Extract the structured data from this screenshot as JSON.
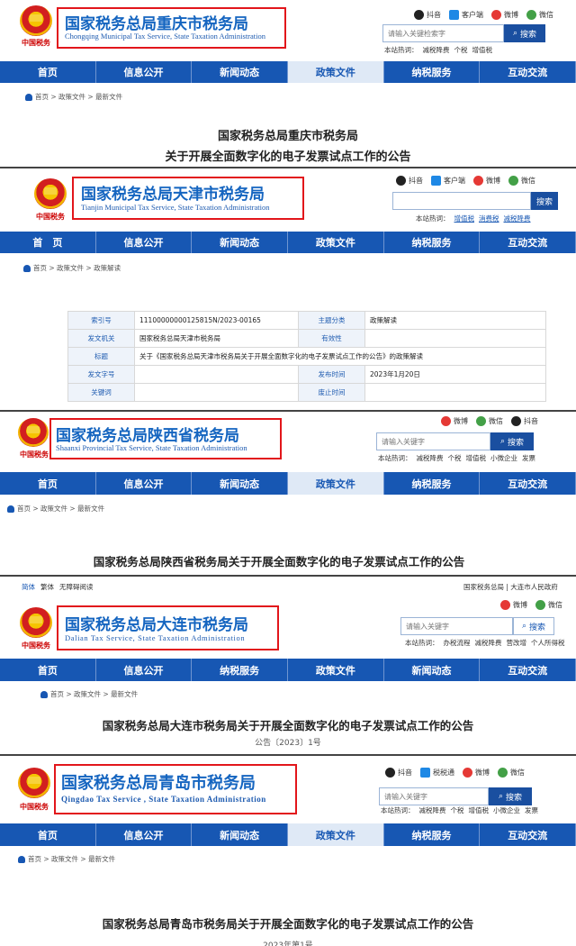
{
  "colors": {
    "nav": "#1757b3",
    "title": "#1565c0",
    "highlight_box": "#e2161b"
  },
  "panels": [
    {
      "title_cn": "国家税务总局重庆市税务局",
      "title_en": "Chongqing Municipal Tax Service, State Taxation Administration",
      "social": [
        "抖音",
        "客户端",
        "微博",
        "微信"
      ],
      "search_placeholder": "请输入关键检索字",
      "search_button": "搜索",
      "hot": [
        "本站热词：",
        "减税降费",
        "个税",
        "增值税"
      ],
      "nav": [
        "首页",
        "信息公开",
        "新闻动态",
        "政策文件",
        "纳税服务",
        "互动交流"
      ],
      "active_nav": "政策文件",
      "breadcrumb": "首页 > 政策文件 > 最新文件",
      "doc_line1": "国家税务总局重庆市税务局",
      "doc_line2": "关于开展全面数字化的电子发票试点工作的公告",
      "seal": "中国税务"
    },
    {
      "title_cn": "国家税务总局天津市税务局",
      "title_en": "Tianjin Municipal Tax Service, State Taxation Administration",
      "social": [
        "抖音",
        "客户端",
        "微博",
        "微信"
      ],
      "search_button": "搜索",
      "hot": [
        "本站热词：",
        "增值税",
        "消费税",
        "减税降费"
      ],
      "nav": [
        "首　页",
        "信息公开",
        "新闻动态",
        "政策文件",
        "纳税服务",
        "互动交流"
      ],
      "breadcrumb": "首页 > 政策文件 > 政策解读",
      "table": {
        "index_k": "索引号",
        "index_v": "11100000000125815N/2023-00165",
        "topic_k": "主题分类",
        "topic_v": "政策解读",
        "org_k": "发文机关",
        "org_v": "国家税务总局天津市税务局",
        "valid_k": "有效性",
        "valid_v": "",
        "title_k": "标题",
        "title_v": "关于《国家税务总局天津市税务局关于开展全面数字化的电子发票试点工作的公告》的政策解读",
        "docno_k": "发文字号",
        "docno_v": "",
        "date_k": "发布时间",
        "date_v": "2023年1月20日",
        "kw_k": "关键词",
        "kw_v": "",
        "abol_k": "废止时间",
        "abol_v": ""
      },
      "seal": "中国税务"
    },
    {
      "title_cn": "国家税务总局陕西省税务局",
      "title_en": "Shaanxi Provincial Tax Service, State Taxation Administration",
      "social": [
        "微博",
        "微信",
        "抖音"
      ],
      "search_placeholder": "请输入关键字",
      "search_button": "搜索",
      "hot": [
        "本站热词：",
        "减税降费",
        "个税",
        "增值税",
        "小微企业",
        "发票"
      ],
      "nav": [
        "首页",
        "信息公开",
        "新闻动态",
        "政策文件",
        "纳税服务",
        "互动交流"
      ],
      "active_nav": "政策文件",
      "breadcrumb": "首页 > 政策文件 > 最新文件",
      "doc_line1": "国家税务总局陕西省税务局关于开展全面数字化的电子发票试点工作的公告",
      "seal": "中国税务"
    },
    {
      "top_left": [
        "简体",
        "繁体",
        "无障碍阅读"
      ],
      "top_right": "国家税务总局 | 大连市人民政府",
      "title_cn": "国家税务总局大连市税务局",
      "title_en": "Dalian Tax Service, State Taxation Administration",
      "social": [
        "微博",
        "微信"
      ],
      "search_placeholder": "请输入关键字",
      "search_button": "搜索",
      "hot": [
        "本站热词：",
        "办税流程",
        "减税降费",
        "营改增",
        "个人所得税"
      ],
      "nav": [
        "首页",
        "信息公开",
        "纳税服务",
        "政策文件",
        "新闻动态",
        "互动交流"
      ],
      "breadcrumb": "首页 > 政策文件 > 最新文件",
      "doc_line1": "国家税务总局大连市税务局关于开展全面数字化的电子发票试点工作的公告",
      "doc_line2": "公告〔2023〕1号",
      "seal": "中国税务"
    },
    {
      "title_cn": "国家税务总局青岛市税务局",
      "title_en": "Qingdao Tax Service , State Taxation Administration",
      "social": [
        "抖音",
        "税税通",
        "微博",
        "微信"
      ],
      "search_placeholder": "请输入关键字",
      "search_button": "搜索",
      "hot": [
        "本站热词：",
        "减税降费",
        "个税",
        "增值税",
        "小微企业",
        "发票"
      ],
      "nav": [
        "首页",
        "信息公开",
        "新闻动态",
        "政策文件",
        "纳税服务",
        "互动交流"
      ],
      "active_nav": "政策文件",
      "breadcrumb": "首页 > 政策文件 > 最新文件",
      "doc_line1": "国家税务总局青岛市税务局关于开展全面数字化的电子发票试点工作的公告",
      "doc_line2": "2023年第1号",
      "seal": "中国税务"
    }
  ]
}
